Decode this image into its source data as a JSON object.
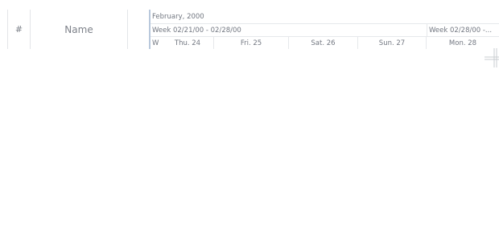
{
  "grid": {
    "columns": [
      {
        "key": "num",
        "label": "#"
      },
      {
        "key": "name",
        "label": "Name"
      }
    ]
  },
  "timeline": {
    "month": "February, 2000",
    "weeks": [
      "Week 02/21/00 - 02/28/00",
      "Week 02/28/00 -..."
    ],
    "days": [
      "W",
      "Thu. 24",
      "Fri. 25",
      "Sat. 26",
      "Sun. 27",
      "Mon. 28"
    ]
  },
  "icons": {
    "resize": "resize-handle-icon"
  },
  "colors": {
    "splitter": "#b8c8dc",
    "gridline": "#e6e8eb",
    "text": "#727781"
  }
}
